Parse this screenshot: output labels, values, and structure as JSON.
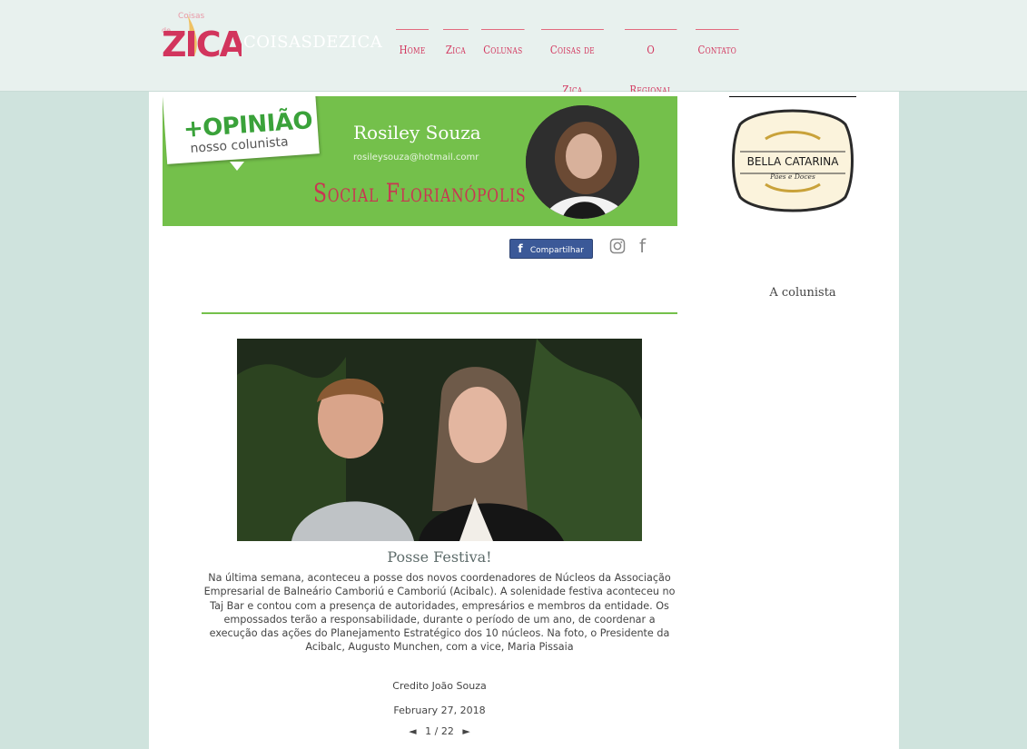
{
  "header": {
    "site_name": "COISASDEZICA",
    "logo_text": "ZICA",
    "logo_small_top": "Coisas",
    "logo_small_left": "de",
    "nav": [
      {
        "label": "Home"
      },
      {
        "label": "Zica"
      },
      {
        "label": "Colunas"
      },
      {
        "label": "Coisas de Zica"
      },
      {
        "label": "O Regional"
      },
      {
        "label": "Contato"
      }
    ]
  },
  "banner": {
    "opiniao_title": "+OPINIÃO",
    "opiniao_sub": "nosso colunista",
    "columnist_name": "Rosiley Souza",
    "columnist_email": "rosileysouza@hotmail.comr",
    "column_title": "Social Florianópolis"
  },
  "share": {
    "button_label": "Compartilhar",
    "fb_glyph": "f"
  },
  "post": {
    "title": "Posse Festiva!",
    "body": "Na última semana, aconteceu a posse dos novos coordenadores de Núcleos da Associação Empresarial de Balneário Camboriú e Camboriú (Acibalc). A solenidade festiva aconteceu no Taj Bar e contou com a presença de autoridades, empresários e membros da entidade. Os empossados terão a responsabilidade, durante o período de um ano, de coordenar a execução das ações do Planejamento Estratégico dos 10 núcleos. Na foto, o Presidente da Acibalc, Augusto Munchen, com a vice, Maria Pissaia",
    "credit": "Credito João Souza",
    "date": "February 27, 2018",
    "pager": "1 / 22",
    "prev": "◄",
    "next": "►"
  },
  "sidebar": {
    "ad_brand": "BELLA CATARINA",
    "ad_sub": "Pães e Doces",
    "colunista_label": "A colunista"
  },
  "colors": {
    "accent_pink": "#d2355d",
    "banner_green": "#74c04b",
    "background": "#cfe3dd"
  }
}
